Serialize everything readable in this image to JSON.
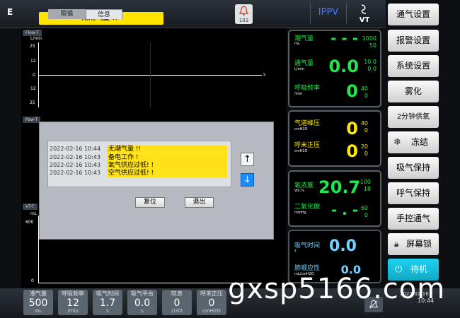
{
  "header": {
    "mode_letter": "E",
    "alarm_banner": "无潮气量 !!",
    "alarm_count": "103",
    "mode_name": "IPPV",
    "vt_icon_label": "VT"
  },
  "waveforms": {
    "flow_tab": "Flow-T",
    "flow_unit": "L/min",
    "flow_ticks": [
      "25",
      "12",
      "0",
      "12",
      "25"
    ],
    "flow_time_unit": "s",
    "paw_tab": "Paw-T",
    "vt_tab": "VT-T",
    "vt_unit": "mL",
    "vt_tick": "600",
    "vt_zero": "0"
  },
  "params": {
    "tidal": {
      "label": "潮气量",
      "unit": "mL",
      "value": "- - -",
      "high": "1000",
      "low": "50"
    },
    "minute_vol": {
      "label": "通气量",
      "unit": "L/min",
      "value": "0.0",
      "high": "10.0",
      "low": "0.0"
    },
    "resp_rate": {
      "label": "呼吸频率",
      "unit": "/min",
      "value": "0",
      "high": "40",
      "low": "0"
    },
    "peak_pressure": {
      "label": "气道峰压",
      "unit": "cmH2O",
      "value": "0",
      "high": "40",
      "low": "0"
    },
    "peep": {
      "label": "呼末正压",
      "unit": "cmH2O",
      "value": "0",
      "high": "20",
      "low": "0"
    },
    "oxygen": {
      "label": "氧浓度",
      "unit": "Vol.%",
      "value": "20.7",
      "high": "100",
      "low": "18"
    },
    "co2": {
      "label": "二氧化碳",
      "unit": "mmHg",
      "value": "- . -",
      "high": "60",
      "low": "0"
    },
    "insp_time": {
      "label": "吸气时间",
      "unit": "s",
      "value": "0.0"
    },
    "compliance": {
      "label": "肺顺应性",
      "unit": "mL/cmH2O",
      "value": "0.0"
    }
  },
  "menu": [
    "通气设置",
    "报警设置",
    "系统设置",
    "雾化",
    "2分钟供氧",
    "冻结",
    "吸气保持",
    "呼气保持",
    "手控通气",
    "屏幕锁",
    "待机"
  ],
  "bottom": [
    {
      "label": "潮气量",
      "value": "500",
      "unit": "mL"
    },
    {
      "label": "呼吸频率",
      "value": "12",
      "unit": "/min"
    },
    {
      "label": "吸气时间",
      "value": "1.7",
      "unit": "s"
    },
    {
      "label": "吸气平台",
      "value": "0.0",
      "unit": "s"
    },
    {
      "label": "叹息",
      "value": "0",
      "unit": "/100"
    },
    {
      "label": "呼末正压",
      "value": "0",
      "unit": "cmH2O"
    }
  ],
  "clock": {
    "date": "2022-02-16",
    "time": "10:44"
  },
  "dialog": {
    "tab_limits": "限值",
    "tab_info": "信息",
    "rows": [
      {
        "ts": "2022-02-16 10:44",
        "msg": "无潮气量 !!"
      },
      {
        "ts": "2022-02-16 10:43",
        "msg": "备电工作 !"
      },
      {
        "ts": "2022-02-16 10:43",
        "msg": "氧气供应过低! !"
      },
      {
        "ts": "2022-02-16 10:43",
        "msg": "空气供应过低! !"
      }
    ],
    "reset_label": "复位",
    "exit_label": "退出"
  },
  "watermark": "gxsp5166.com",
  "colors": {
    "accent_green": "#21e84a",
    "value_yellow": "#ffe600",
    "alarm_yellow": "#ffe400",
    "mode_blue": "#3c78ff"
  }
}
